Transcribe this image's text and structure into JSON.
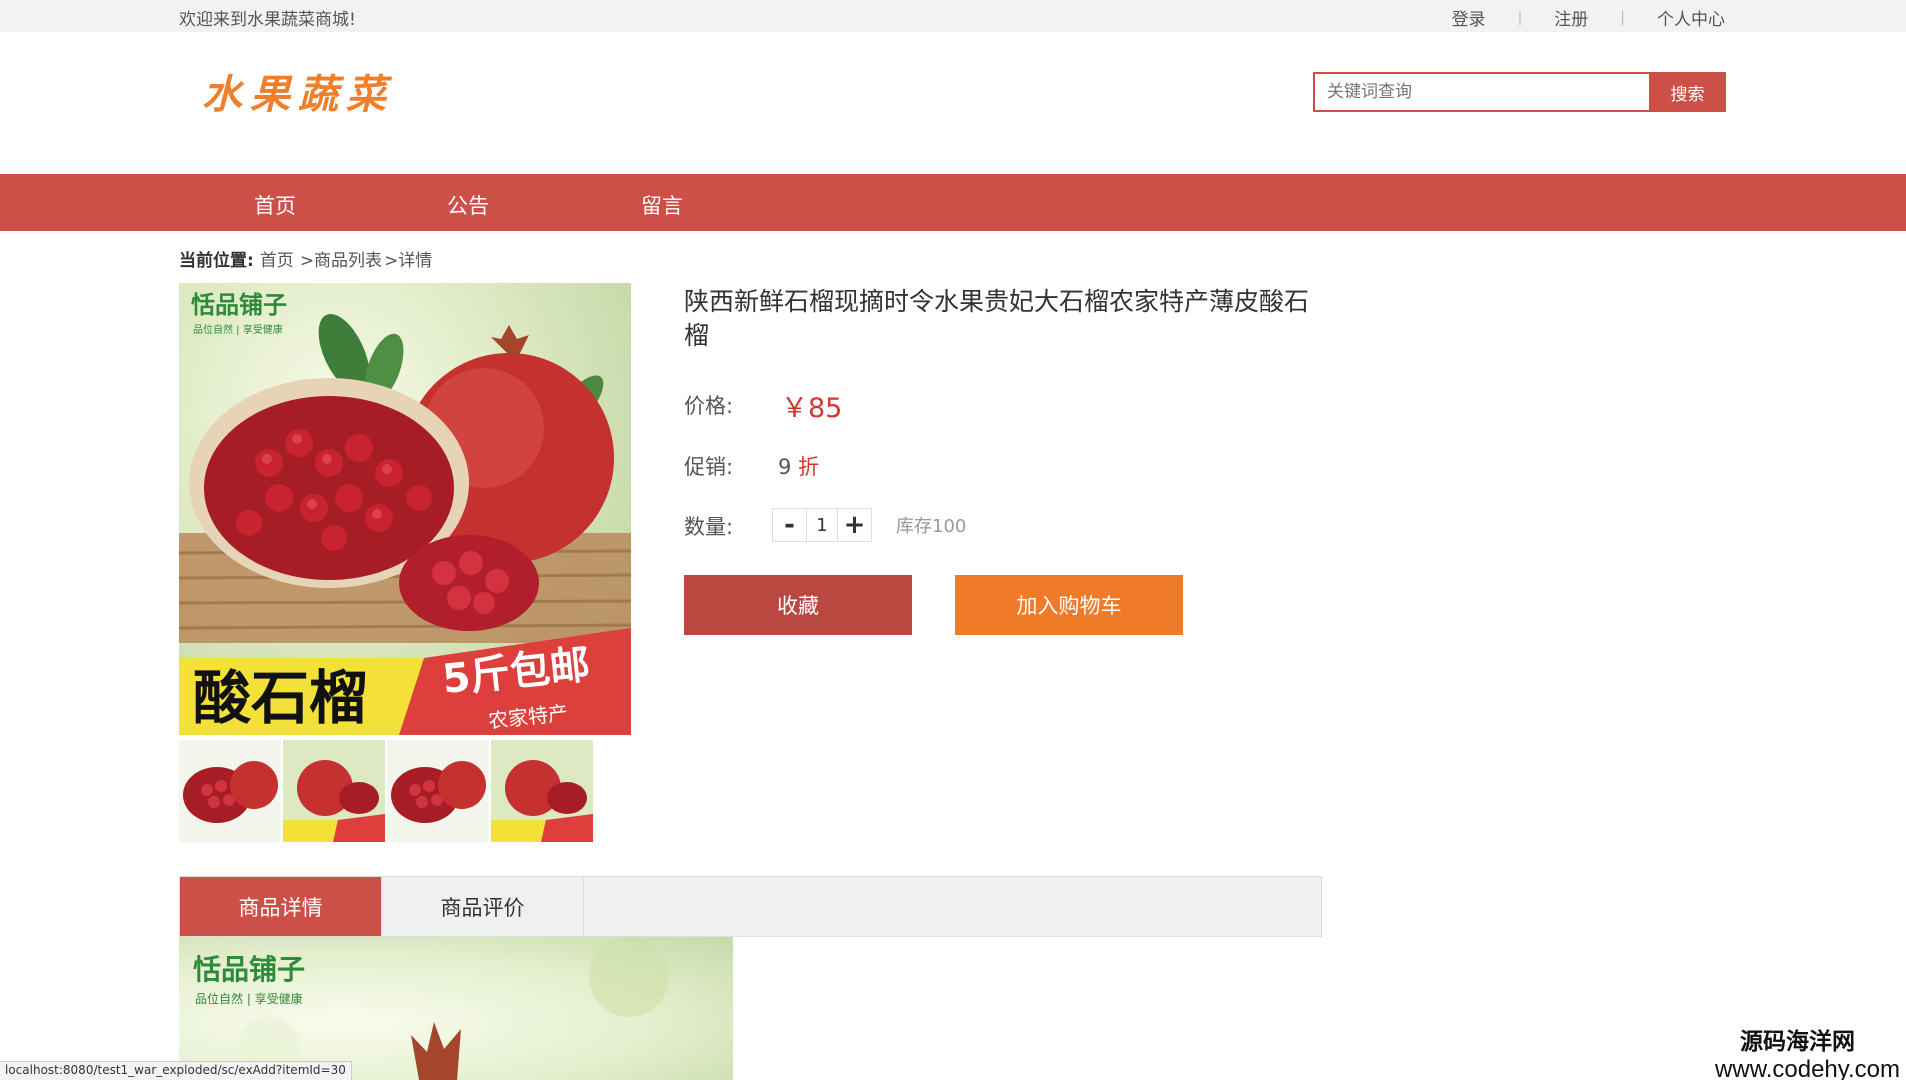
{
  "topbar": {
    "welcome": "欢迎来到水果蔬菜商城!",
    "login": "登录",
    "register": "注册",
    "profile": "个人中心"
  },
  "header": {
    "logo": "水果蔬菜",
    "search_placeholder": "关键词查询",
    "search_button": "搜索"
  },
  "nav": {
    "items": [
      "首页",
      "公告",
      "留言"
    ]
  },
  "breadcrumb": {
    "label": "当前位置:",
    "items": [
      "首页",
      ">商品列表",
      ">详情"
    ]
  },
  "product": {
    "image_brand": "恬品铺子",
    "image_slogan": "品位自然 | 享受健康",
    "image_banner_left": "酸石榴",
    "image_banner_right": "5斤包邮",
    "image_banner_sub": "农家特产",
    "title": "陕西新鲜石榴现摘时令水果贵妃大石榴农家特产薄皮酸石榴",
    "price_label": "价格:",
    "price": "￥85",
    "promo_label": "促销:",
    "promo_value": "9",
    "promo_unit": "折",
    "qty_label": "数量:",
    "qty_minus": "-",
    "qty_value": "1",
    "qty_plus": "+",
    "stock": "库存100",
    "fav_button": "收藏",
    "cart_button": "加入购物车"
  },
  "tabs": {
    "detail": "商品详情",
    "reviews": "商品评价"
  },
  "statusbar": {
    "url": "localhost:8080/test1_war_exploded/sc/exAdd?itemId=30"
  },
  "watermark": {
    "line1": "源码海洋网",
    "line2": "www.codehy.com"
  }
}
